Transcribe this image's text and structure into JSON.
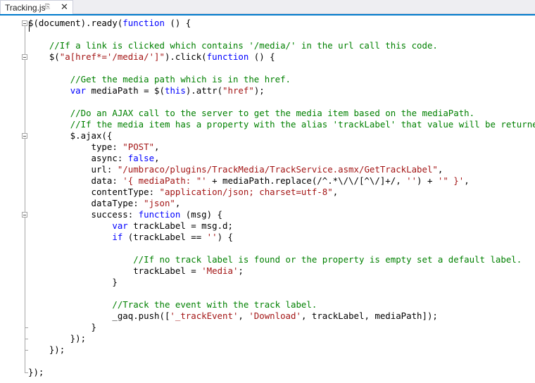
{
  "tab": {
    "title": "Tracking.js",
    "pin_icon": "pin-icon",
    "close_icon": "close-icon"
  },
  "colors": {
    "keyword": "#0000ff",
    "comment": "#008000",
    "string": "#a31515",
    "text": "#000000",
    "accent": "#007acc"
  },
  "code": [
    [
      [
        "t",
        "$(document).ready("
      ],
      [
        "k",
        "function"
      ],
      [
        "t",
        " () {"
      ]
    ],
    [],
    [
      [
        "t",
        "    "
      ],
      [
        "c",
        "//If a link is clicked which contains '/media/' in the url call this code."
      ]
    ],
    [
      [
        "t",
        "    $("
      ],
      [
        "s",
        "\"a[href*='/media/']\""
      ],
      [
        "t",
        ").click("
      ],
      [
        "k",
        "function"
      ],
      [
        "t",
        " () {"
      ]
    ],
    [],
    [
      [
        "t",
        "        "
      ],
      [
        "c",
        "//Get the media path which is in the href."
      ]
    ],
    [
      [
        "t",
        "        "
      ],
      [
        "k",
        "var"
      ],
      [
        "t",
        " mediaPath = $("
      ],
      [
        "k",
        "this"
      ],
      [
        "t",
        ").attr("
      ],
      [
        "s",
        "\"href\""
      ],
      [
        "t",
        ");"
      ]
    ],
    [],
    [
      [
        "t",
        "        "
      ],
      [
        "c",
        "//Do an AJAX call to the server to get the media item based on the mediaPath."
      ]
    ],
    [
      [
        "t",
        "        "
      ],
      [
        "c",
        "//If the media item has a property with the alias 'trackLabel' that value will be returned."
      ]
    ],
    [
      [
        "t",
        "        $.ajax({"
      ]
    ],
    [
      [
        "t",
        "            type: "
      ],
      [
        "s",
        "\"POST\""
      ],
      [
        "t",
        ","
      ]
    ],
    [
      [
        "t",
        "            async: "
      ],
      [
        "k",
        "false"
      ],
      [
        "t",
        ","
      ]
    ],
    [
      [
        "t",
        "            url: "
      ],
      [
        "s",
        "\"/umbraco/plugins/TrackMedia/TrackService.asmx/GetTrackLabel\""
      ],
      [
        "t",
        ","
      ]
    ],
    [
      [
        "t",
        "            data: "
      ],
      [
        "s",
        "'{ mediaPath: \"'"
      ],
      [
        "t",
        " + mediaPath.replace(/^.*\\/\\/[^\\/]+/, "
      ],
      [
        "s",
        "''"
      ],
      [
        "t",
        ") + "
      ],
      [
        "s",
        "'\" }'"
      ],
      [
        "t",
        ","
      ]
    ],
    [
      [
        "t",
        "            contentType: "
      ],
      [
        "s",
        "\"application/json; charset=utf-8\""
      ],
      [
        "t",
        ","
      ]
    ],
    [
      [
        "t",
        "            dataType: "
      ],
      [
        "s",
        "\"json\""
      ],
      [
        "t",
        ","
      ]
    ],
    [
      [
        "t",
        "            success: "
      ],
      [
        "k",
        "function"
      ],
      [
        "t",
        " (msg) {"
      ]
    ],
    [
      [
        "t",
        "                "
      ],
      [
        "k",
        "var"
      ],
      [
        "t",
        " trackLabel = msg.d;"
      ]
    ],
    [
      [
        "t",
        "                "
      ],
      [
        "k",
        "if"
      ],
      [
        "t",
        " (trackLabel == "
      ],
      [
        "s",
        "''"
      ],
      [
        "t",
        ") {"
      ]
    ],
    [],
    [
      [
        "t",
        "                    "
      ],
      [
        "c",
        "//If no track label is found or the property is empty set a default label."
      ]
    ],
    [
      [
        "t",
        "                    trackLabel = "
      ],
      [
        "s",
        "'Media'"
      ],
      [
        "t",
        ";"
      ]
    ],
    [
      [
        "t",
        "                }"
      ]
    ],
    [],
    [
      [
        "t",
        "                "
      ],
      [
        "c",
        "//Track the event with the track label."
      ]
    ],
    [
      [
        "t",
        "                _gaq.push(["
      ],
      [
        "s",
        "'_trackEvent'"
      ],
      [
        "t",
        ", "
      ],
      [
        "s",
        "'Download'"
      ],
      [
        "t",
        ", trackLabel, mediaPath]);"
      ]
    ],
    [
      [
        "t",
        "            }"
      ]
    ],
    [
      [
        "t",
        "        });"
      ]
    ],
    [
      [
        "t",
        "    });"
      ]
    ],
    [],
    [
      [
        "t",
        "});"
      ]
    ]
  ]
}
